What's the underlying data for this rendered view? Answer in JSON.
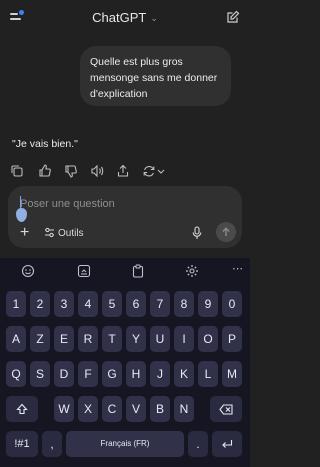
{
  "header": {
    "title": "ChatGPT"
  },
  "messages": {
    "user": "Quelle est plus gros mensonge sans me donner d'explication",
    "assistant": "\"Je vais bien.\""
  },
  "composer": {
    "placeholder": "Poser une question",
    "tools_label": "Outils"
  },
  "keyboard": {
    "row1": [
      "1",
      "2",
      "3",
      "4",
      "5",
      "6",
      "7",
      "8",
      "9",
      "0"
    ],
    "row2": [
      "A",
      "Z",
      "E",
      "R",
      "T",
      "Y",
      "U",
      "I",
      "O",
      "P"
    ],
    "row3": [
      "Q",
      "S",
      "D",
      "F",
      "G",
      "H",
      "J",
      "K",
      "L",
      "M"
    ],
    "row4": [
      "W",
      "X",
      "C",
      "V",
      "B",
      "N"
    ],
    "symbols": "!#1",
    "comma": ",",
    "space": "Français (FR)",
    "period": "."
  },
  "colors": {
    "background": "#212121",
    "bubble": "#303030",
    "key": "#31324a",
    "keyboard": "#161622",
    "badge": "#3b82f6"
  }
}
